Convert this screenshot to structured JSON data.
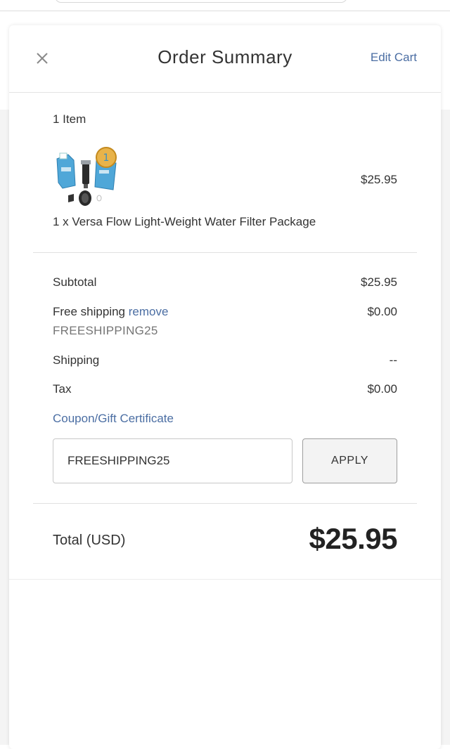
{
  "header": {
    "title": "Order Summary",
    "edit_cart_label": "Edit Cart",
    "close_icon": "close-icon"
  },
  "cart": {
    "item_count_label": "1 Item",
    "items": [
      {
        "name": "1 x Versa Flow Light-Weight Water Filter Package",
        "price": "$25.95",
        "thumbnail_icon": "water-filter-package-thumbnail"
      }
    ]
  },
  "summary": {
    "subtotal_label": "Subtotal",
    "subtotal_value": "$25.95",
    "free_shipping_label": "Free shipping",
    "remove_label": "remove",
    "free_shipping_value": "$0.00",
    "applied_code": "FREESHIPPING25",
    "shipping_label": "Shipping",
    "shipping_value": "--",
    "tax_label": "Tax",
    "tax_value": "$0.00"
  },
  "coupon": {
    "link_label": "Coupon/Gift Certificate",
    "input_value": "FREESHIPPING25",
    "apply_label": "APPLY"
  },
  "total": {
    "label": "Total (USD)",
    "value": "$25.95"
  },
  "colors": {
    "link": "#4b6ea3",
    "text": "#333333",
    "divider": "#e0e0e0"
  }
}
